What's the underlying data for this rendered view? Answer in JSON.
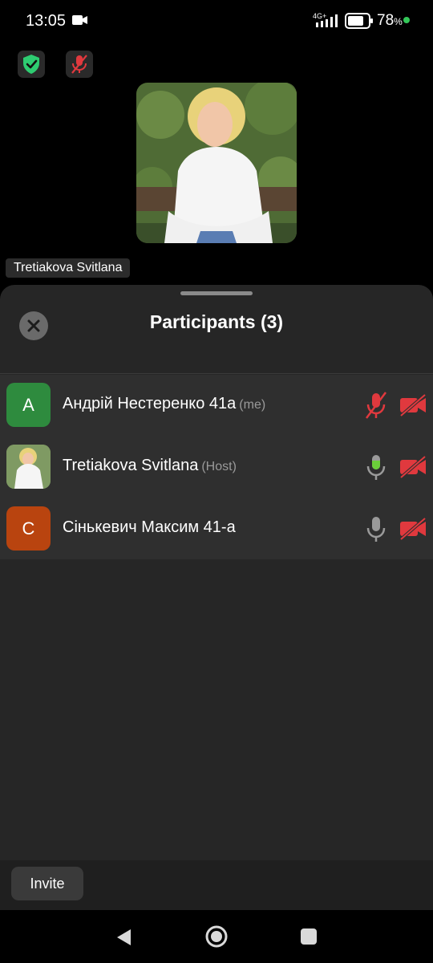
{
  "status": {
    "time": "13:05",
    "network": "4G+",
    "battery_percent": "78",
    "battery_unit": "%"
  },
  "meeting": {
    "speaker_name": "Tretiakova Svitlana",
    "shield_color": "#2ecc71",
    "mute_color": "#e0393e"
  },
  "participants_panel": {
    "title": "Participants (3)",
    "participants": [
      {
        "initial": "A",
        "name": "Андрій Нестеренко 41а",
        "tag": "(me)",
        "avatar_color": "#2e8b3e",
        "mic": "muted",
        "video": "off"
      },
      {
        "initial": "",
        "name": "Tretiakova Svitlana",
        "tag": "(Host)",
        "avatar_color": "#8aa070",
        "mic": "active",
        "video": "off"
      },
      {
        "initial": "C",
        "name": "Сінькевич Максим 41-а",
        "tag": "",
        "avatar_color": "#b9440f",
        "mic": "idle",
        "video": "off"
      }
    ]
  },
  "footer": {
    "invite_label": "Invite"
  },
  "icons": {
    "mic_active_color": "#6bcf3a",
    "mic_idle_color": "#9a9a9a",
    "muted_color": "#e0393e"
  }
}
